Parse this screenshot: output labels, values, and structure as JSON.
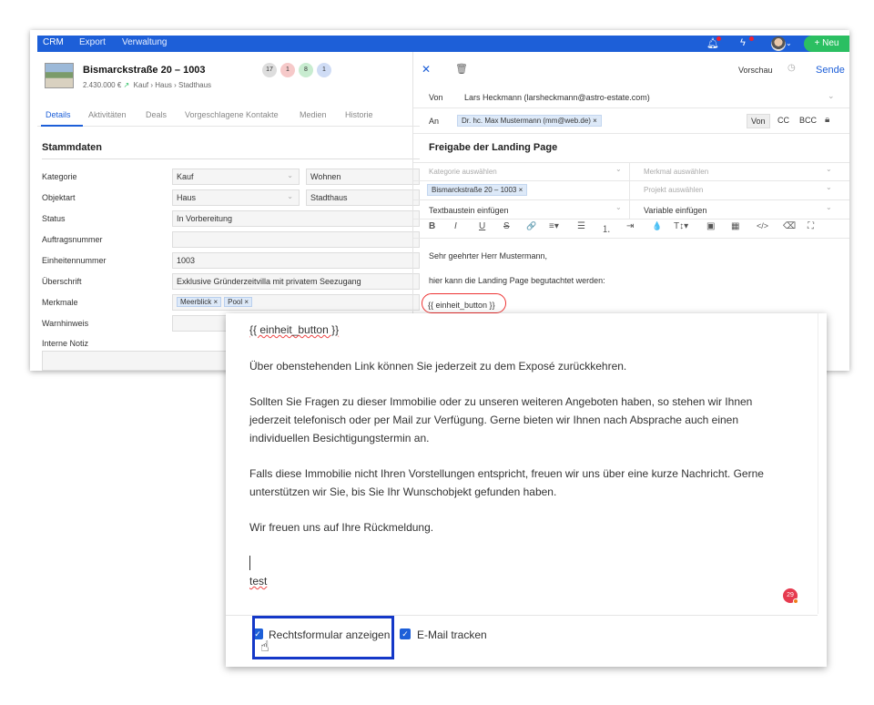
{
  "topnav": {
    "items": [
      "CRM",
      "Export",
      "Verwaltung"
    ],
    "new_button": "+ Neu"
  },
  "property": {
    "title": "Bismarckstraße 20 – 1003",
    "price": "2.430.000 €",
    "path": "Kauf › Haus › Stadthaus",
    "badges": [
      "17",
      "1",
      "8",
      "1"
    ]
  },
  "tabs": [
    "Details",
    "Aktivitäten",
    "Deals",
    "Vorgeschlagene Kontakte",
    "Medien",
    "Historie"
  ],
  "stammdaten": {
    "title": "Stammdaten",
    "rows": [
      {
        "label": "Kategorie",
        "value1": "Kauf",
        "value2": "Wohnen"
      },
      {
        "label": "Objektart",
        "value1": "Haus",
        "value2": "Stadthaus"
      },
      {
        "label": "Status",
        "value1": "In Vorbereitung"
      },
      {
        "label": "Auftragsnummer",
        "value1": ""
      },
      {
        "label": "Einheitennummer",
        "value1": "1003"
      },
      {
        "label": "Überschrift",
        "value1": "Exklusive Gründerzeitvilla mit privatem Seezugang"
      },
      {
        "label": "Merkmale",
        "tags": [
          "Meerblick ×",
          "Pool ×"
        ]
      },
      {
        "label": "Warnhinweis",
        "value1": ""
      },
      {
        "label": "Interne Notiz",
        "value1": ""
      }
    ]
  },
  "email": {
    "preview": "Vorschau",
    "send": "Sende",
    "from_label": "Von",
    "from_value": "Lars Heckmann (larsheckmann@astro-estate.com)",
    "to_label": "An",
    "to_chip": "Dr. hc. Max Mustermann (mm@web.de) ×",
    "cc_buttons": [
      "Von",
      "CC",
      "BCC"
    ],
    "subject": "Freigabe der Landing Page",
    "category_placeholder": "Kategorie auswählen",
    "feature_placeholder": "Merkmal auswählen",
    "unit_chip": "Bismarckstraße 20 – 1003 ×",
    "project_placeholder": "Projekt auswählen",
    "textbaustein": "Textbaustein einfügen",
    "variable": "Variable einfügen",
    "toolbar": [
      "B",
      "I",
      "U",
      "S",
      "🔗",
      "≡▾",
      "☰",
      "⒈",
      "⇥",
      "💧",
      "T↕▾",
      "▣",
      "▦",
      "</>",
      "⌫",
      "⛶"
    ],
    "greeting": "Sehr geehrter Herr Mustermann,",
    "line1": "hier kann die Landing Page begutachtet werden:",
    "button_var": "{{ einheit_button }}"
  },
  "editor": {
    "var_line": "{{ einheit_button }}",
    "p1": "Über obenstehenden Link können Sie jederzeit zu dem Exposé zurückkehren.",
    "p2": "Sollten Sie Fragen zu dieser Immobilie oder zu unseren weiteren Angeboten haben, so stehen wir Ihnen jederzeit telefonisch oder per Mail zur Verfügung. Gerne bieten wir Ihnen nach Absprache auch einen individuellen Besichtigungstermin an.",
    "p3": "Falls diese Immobilie nicht Ihren Vorstellungen entspricht, freuen wir uns über eine kurze Nachricht. Gerne unterstützen wir Sie, bis Sie Ihr Wunschobjekt gefunden haben.",
    "p4": "Wir freuen uns auf Ihre Rückmeldung.",
    "p5": "test",
    "counter": "29",
    "checkbox1": "Rechtsformular anzeigen",
    "checkbox2": "E-Mail tracken"
  }
}
